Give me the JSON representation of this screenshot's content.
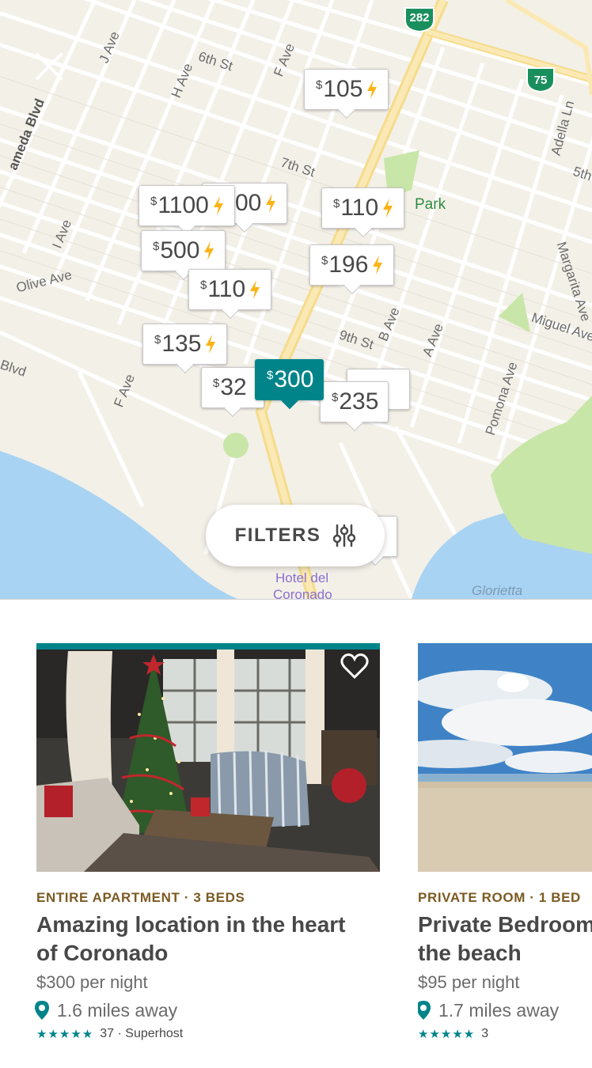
{
  "map": {
    "street_labels": [
      "J Ave",
      "6th St",
      "H Ave",
      "F Ave",
      "ameda Blvd",
      "7th St",
      "I Ave",
      "Olive Ave",
      "Blvd",
      "F Ave",
      "Park",
      "Adella Ln",
      "5th",
      "Margarita Ave",
      "Miguel Ave",
      "9th St",
      "B Ave",
      "A Ave",
      "Pomona Ave",
      "Glorietta",
      "Hotel del",
      "Coronado"
    ],
    "route_shields": [
      "282",
      "75"
    ],
    "price_pins": [
      {
        "currency": "$",
        "amount": "105",
        "instant": true
      },
      {
        "currency": "",
        "amount": "00",
        "instant": true
      },
      {
        "currency": "$",
        "amount": "1100",
        "instant": true
      },
      {
        "currency": "$",
        "amount": "110",
        "instant": true
      },
      {
        "currency": "$",
        "amount": "500",
        "instant": true
      },
      {
        "currency": "$",
        "amount": "196",
        "instant": true
      },
      {
        "currency": "$",
        "amount": "110",
        "instant": true
      },
      {
        "currency": "$",
        "amount": "135",
        "instant": true
      },
      {
        "currency": "$",
        "amount": "32",
        "instant": false
      },
      {
        "currency": "$",
        "amount": "235",
        "instant": false
      },
      {
        "currency": "$",
        "amount": "300",
        "instant": false,
        "selected": true
      }
    ],
    "filters_label": "FILTERS",
    "colors": {
      "teal": "#00848a",
      "bolt": "#fcb315",
      "water": "#a9d3f2",
      "park": "#c8e6a8",
      "road": "#fbe5a6"
    }
  },
  "listings": [
    {
      "type": "ENTIRE APARTMENT · 3 BEDS",
      "title_line1": "Amazing location in the heart",
      "title_line2": "of Coronado",
      "price": "$300 per night",
      "distance": "1.6 miles away",
      "stars": "★★★★★",
      "rating_text": "37 · Superhost"
    },
    {
      "type": "PRIVATE ROOM · 1 BED",
      "title_line1": "Private Bedroom",
      "title_line2": "the beach",
      "price": "$95 per night",
      "distance": "1.7 miles away",
      "stars": "★★★★★",
      "rating_text": "3"
    }
  ]
}
